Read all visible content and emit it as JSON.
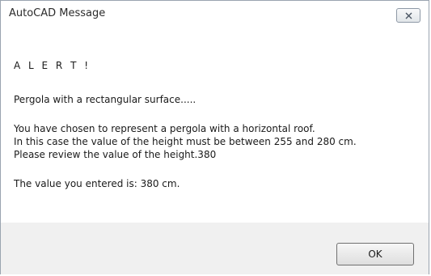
{
  "dialog": {
    "title": "AutoCAD Message",
    "close_icon": "close-icon",
    "lines": [
      "A L E R T !",
      "Pergola with a rectangular surface.....",
      "You have chosen to represent a pergola with a horizontal roof.",
      "In this case the value of the height must be between 255 and 280 cm.",
      "Please review the value of the height.380",
      "The value you entered is: 380 cm."
    ],
    "ok_label": "OK"
  }
}
